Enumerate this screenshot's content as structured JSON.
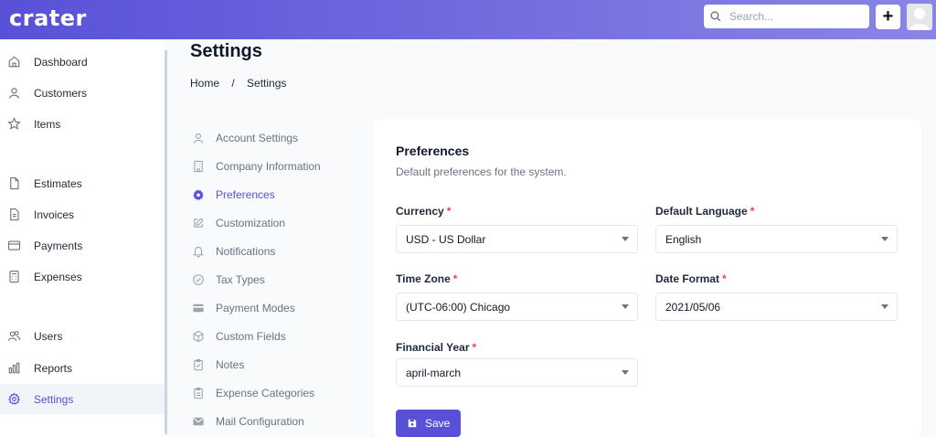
{
  "app": {
    "logo": "crater"
  },
  "search": {
    "placeholder": "Search..."
  },
  "header": {
    "plus_label": "+"
  },
  "sidebar": {
    "items": [
      {
        "label": "Dashboard",
        "icon": "home-icon"
      },
      {
        "label": "Customers",
        "icon": "user-icon"
      },
      {
        "label": "Items",
        "icon": "star-icon"
      },
      {
        "label": "Estimates",
        "icon": "document-icon"
      },
      {
        "label": "Invoices",
        "icon": "invoice-icon"
      },
      {
        "label": "Payments",
        "icon": "credit-card-icon"
      },
      {
        "label": "Expenses",
        "icon": "calculator-icon"
      },
      {
        "label": "Users",
        "icon": "users-icon"
      },
      {
        "label": "Reports",
        "icon": "chart-bar-icon"
      },
      {
        "label": "Settings",
        "icon": "gear-icon",
        "active": true
      }
    ]
  },
  "page": {
    "title": "Settings"
  },
  "breadcrumb": {
    "home": "Home",
    "separator": "/",
    "current": "Settings"
  },
  "settings_nav": {
    "items": [
      {
        "label": "Account Settings",
        "icon": "user-icon"
      },
      {
        "label": "Company Information",
        "icon": "building-icon"
      },
      {
        "label": "Preferences",
        "icon": "cog-icon",
        "active": true
      },
      {
        "label": "Customization",
        "icon": "pencil-square-icon"
      },
      {
        "label": "Notifications",
        "icon": "bell-icon"
      },
      {
        "label": "Tax Types",
        "icon": "check-circle-icon"
      },
      {
        "label": "Payment Modes",
        "icon": "credit-card-icon"
      },
      {
        "label": "Custom Fields",
        "icon": "cube-icon"
      },
      {
        "label": "Notes",
        "icon": "clipboard-check-icon"
      },
      {
        "label": "Expense Categories",
        "icon": "clipboard-list-icon"
      },
      {
        "label": "Mail Configuration",
        "icon": "mail-icon"
      }
    ]
  },
  "preferences": {
    "title": "Preferences",
    "subtitle": "Default preferences for the system.",
    "currency": {
      "label": "Currency",
      "required": "*",
      "value": "USD - US Dollar"
    },
    "language": {
      "label": "Default Language",
      "required": "*",
      "value": "English"
    },
    "timezone": {
      "label": "Time Zone",
      "required": "*",
      "value": "(UTC-06:00) Chicago"
    },
    "date_format": {
      "label": "Date Format",
      "required": "*",
      "value": "2021/05/06"
    },
    "financial_year": {
      "label": "Financial Year",
      "required": "*",
      "value": "april-march"
    },
    "save_label": "Save"
  },
  "colors": {
    "primary": "#5851d8",
    "required": "#ef4444"
  }
}
